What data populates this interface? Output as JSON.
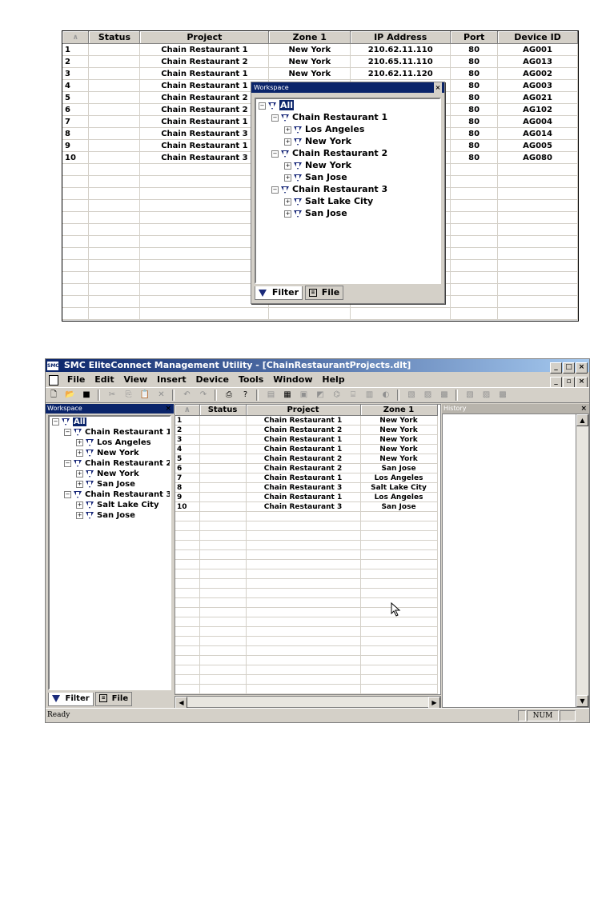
{
  "table1": {
    "headers": [
      "",
      "Status",
      "Project",
      "Zone 1",
      "IP Address",
      "Port",
      "Device ID"
    ],
    "rows": [
      [
        "1",
        "",
        "Chain Restaurant 1",
        "New York",
        "210.62.11.110",
        "80",
        "AG001"
      ],
      [
        "2",
        "",
        "Chain Restaurant 2",
        "New York",
        "210.65.11.110",
        "80",
        "AG013"
      ],
      [
        "3",
        "",
        "Chain Restaurant 1",
        "New York",
        "210.62.11.120",
        "80",
        "AG002"
      ],
      [
        "4",
        "",
        "Chain Restaurant 1",
        "",
        "",
        "80",
        "AG003"
      ],
      [
        "5",
        "",
        "Chain Restaurant 2",
        "",
        "",
        "80",
        "AG021"
      ],
      [
        "6",
        "",
        "Chain Restaurant 2",
        "",
        "",
        "80",
        "AG102"
      ],
      [
        "7",
        "",
        "Chain Restaurant 1",
        "",
        "",
        "80",
        "AG004"
      ],
      [
        "8",
        "",
        "Chain Restaurant 3",
        "",
        "",
        "80",
        "AG014"
      ],
      [
        "9",
        "",
        "Chain Restaurant 1",
        "",
        "",
        "80",
        "AG005"
      ],
      [
        "10",
        "",
        "Chain Restaurant 3",
        "",
        "",
        "80",
        "AG080"
      ]
    ]
  },
  "workspace": {
    "title": "Workspace",
    "close": "×",
    "tree": [
      {
        "level": 0,
        "label": "All",
        "toggle": "−",
        "highlighted": true
      },
      {
        "level": 1,
        "label": "Chain Restaurant 1",
        "toggle": "−"
      },
      {
        "level": 2,
        "label": "Los Angeles",
        "toggle": "+"
      },
      {
        "level": 2,
        "label": "New York",
        "toggle": "+"
      },
      {
        "level": 1,
        "label": "Chain Restaurant 2",
        "toggle": "−"
      },
      {
        "level": 2,
        "label": "New York",
        "toggle": "+"
      },
      {
        "level": 2,
        "label": "San Jose",
        "toggle": "+"
      },
      {
        "level": 1,
        "label": "Chain Restaurant 3",
        "toggle": "−"
      },
      {
        "level": 2,
        "label": "Salt Lake City",
        "toggle": "+"
      },
      {
        "level": 2,
        "label": "San Jose",
        "toggle": "+"
      }
    ],
    "tabs": {
      "filter": "Filter",
      "file": "File"
    }
  },
  "app": {
    "icon_text": "SMC",
    "title": "SMC EliteConnect Management Utility - [ChainRestaurantProjects.dlt]",
    "window_buttons": [
      "_",
      "□",
      "×"
    ],
    "mdi_buttons": [
      "_",
      "▫",
      "×"
    ],
    "menu": [
      "File",
      "Edit",
      "View",
      "Insert",
      "Device",
      "Tools",
      "Window",
      "Help"
    ],
    "history_title": "History",
    "history_close": "×",
    "status_ready": "Ready",
    "status_num": "NUM"
  },
  "table2": {
    "headers": [
      "",
      "Status",
      "Project",
      "Zone 1"
    ],
    "rows": [
      [
        "1",
        "",
        "Chain Restaurant 1",
        "New York"
      ],
      [
        "2",
        "",
        "Chain Restaurant 2",
        "New York"
      ],
      [
        "3",
        "",
        "Chain Restaurant 1",
        "New York"
      ],
      [
        "4",
        "",
        "Chain Restaurant 1",
        "New York"
      ],
      [
        "5",
        "",
        "Chain Restaurant 2",
        "New York"
      ],
      [
        "6",
        "",
        "Chain Restaurant 2",
        "San Jose"
      ],
      [
        "7",
        "",
        "Chain Restaurant 1",
        "Los Angeles"
      ],
      [
        "8",
        "",
        "Chain Restaurant 3",
        "Salt Lake City"
      ],
      [
        "9",
        "",
        "Chain Restaurant 1",
        "Los Angeles"
      ],
      [
        "10",
        "",
        "Chain Restaurant 3",
        "San Jose"
      ]
    ]
  },
  "toolbar_icons": [
    "new-icon",
    "open-icon",
    "save-icon",
    "cut-icon",
    "copy-icon",
    "paste-icon",
    "delete-icon",
    "undo-icon",
    "redo-icon",
    "print-icon",
    "help-icon",
    "device-icon",
    "device-icon",
    "device-icon",
    "device-icon",
    "device-icon",
    "device-icon",
    "device-icon",
    "device-icon",
    "device-icon",
    "device-icon",
    "device-icon",
    "device-icon",
    "device-icon",
    "device-icon"
  ]
}
